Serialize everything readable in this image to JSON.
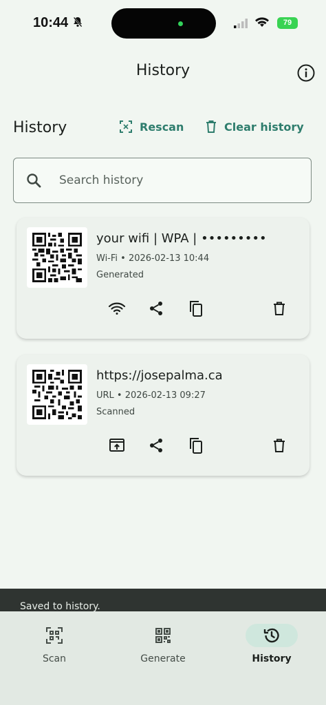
{
  "status_bar": {
    "time": "10:44",
    "battery": "79"
  },
  "app_bar": {
    "title": "History"
  },
  "header": {
    "title": "History",
    "rescan_label": "Rescan",
    "clear_label": "Clear history"
  },
  "search": {
    "placeholder": "Search history",
    "value": ""
  },
  "items": [
    {
      "title": "your wifi | WPA | •••••••••",
      "meta": "Wi-Fi • 2026-02-13 10:44",
      "status": "Generated",
      "actions": [
        "wifi-icon",
        "share-icon",
        "copy-icon",
        "delete-icon"
      ]
    },
    {
      "title": "https://josepalma.ca",
      "meta": "URL • 2026-02-13 09:27",
      "status": "Scanned",
      "actions": [
        "open-in-browser-icon",
        "share-icon",
        "copy-icon",
        "delete-icon"
      ]
    }
  ],
  "snackbar": {
    "text": "Saved to history."
  },
  "nav": {
    "items": [
      {
        "label": "Scan"
      },
      {
        "label": "Generate"
      },
      {
        "label": "History",
        "active": true
      }
    ]
  },
  "colors": {
    "accent": "#2e7d6d",
    "background": "#f1f6f1",
    "card": "#edf2ed",
    "nav_active_pill": "#cfe7dd"
  }
}
